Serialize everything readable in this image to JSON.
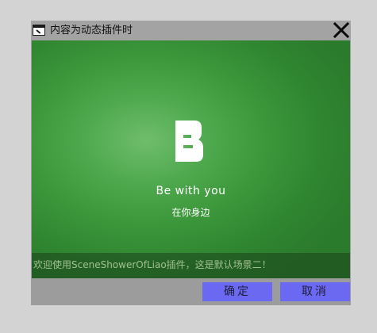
{
  "dialog": {
    "title": "内容为动态插件时",
    "close_icon": "close-icon",
    "window_icon": "window-icon"
  },
  "content": {
    "logo_icon": "letter-b-logo-icon",
    "tagline_en": "Be with you",
    "tagline_cn": "在你身边",
    "welcome_message": "欢迎使用SceneShowerOfLiao插件，这是默认场景二！"
  },
  "buttons": {
    "ok_label": "确定",
    "cancel_label": "取消"
  },
  "colors": {
    "page_background": "#d3d3d3",
    "dialog_frame": "#9c9c9c",
    "content_green": "#3c973b",
    "button_blue": "#6b68f2",
    "welcome_text": "#a0c08f"
  }
}
